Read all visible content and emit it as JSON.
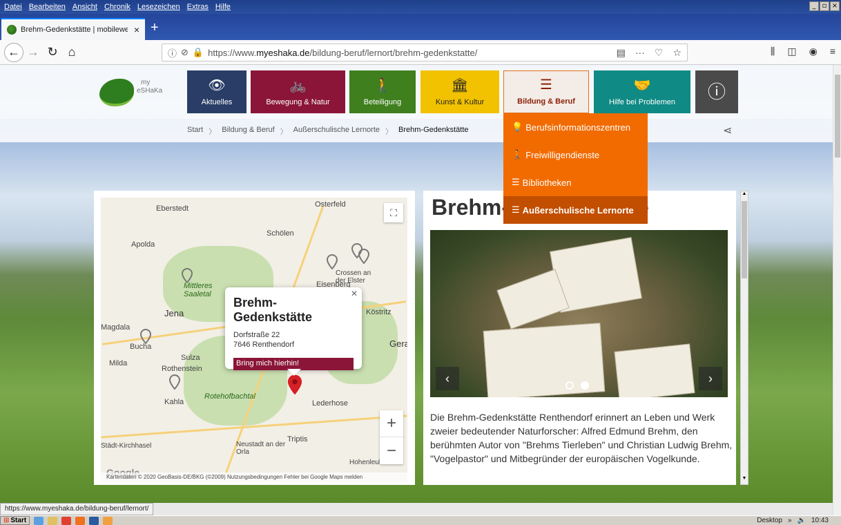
{
  "browser": {
    "menu": [
      "Datei",
      "Bearbeiten",
      "Ansicht",
      "Chronik",
      "Lesezeichen",
      "Extras",
      "Hilfe"
    ],
    "window_buttons": [
      "_",
      "×"
    ],
    "tab_title": "Brehm-Gedenkstätte | mobileweb",
    "tab_close": "×",
    "new_tab": "+",
    "url_prefix": "https://www.",
    "url_domain": "myeshaka.de",
    "url_path": "/bildung-beruf/lernort/brehm-gedenkstatte/",
    "status_link": "https://www.myeshaka.de/bildung-beruf/lernort/"
  },
  "site": {
    "logo_line1": "my",
    "logo_line2": "eSHaKa",
    "nav": [
      {
        "label": "Aktuelles",
        "icon": "eye-icon",
        "glyph": "👁",
        "color": "#2a3d66"
      },
      {
        "label": "Bewegung & Natur",
        "icon": "bicycle-icon",
        "glyph": "🚲",
        "color": "#8a1538"
      },
      {
        "label": "Beteiligung",
        "icon": "person-walking-icon",
        "glyph": "🚶",
        "color": "#3f7f1e"
      },
      {
        "label": "Kunst & Kultur",
        "icon": "building-icon",
        "glyph": "🏛",
        "color": "#f2c200"
      },
      {
        "label": "Bildung & Beruf",
        "icon": "stack-icon",
        "glyph": "☰",
        "color": "#f26b00"
      },
      {
        "label": "Hilfe bei Problemen",
        "icon": "helping-hand-icon",
        "glyph": "🤝",
        "color": "#0f8a84"
      },
      {
        "label": "",
        "icon": "info-icon",
        "glyph": "ⓘ",
        "color": "#4a4a4a"
      }
    ],
    "breadcrumb": [
      "Start",
      "Bildung & Beruf",
      "Außerschulische Lernorte",
      "Brehm-Gedenkstätte"
    ],
    "dropdown": [
      {
        "label": "Berufsinformationszentren",
        "icon": "bulb-icon",
        "glyph": "💡"
      },
      {
        "label": "Freiwilligendienste",
        "icon": "person-walking-icon",
        "glyph": "🚶"
      },
      {
        "label": "Bibliotheken",
        "icon": "stack-icon",
        "glyph": "☰"
      },
      {
        "label": "Außerschulische Lernorte",
        "icon": "stack-icon",
        "glyph": "☰",
        "active": true
      }
    ]
  },
  "map": {
    "labels": [
      "Eberstedt",
      "Osterfeld",
      "Schölen",
      "Apolda",
      "Mittleres Saaletal",
      "Eisenberg",
      "Crossen an der Elster",
      "Jena",
      "Magdala",
      "Köstritz",
      "Gera",
      "Bucha",
      "Sulza",
      "Milda",
      "Rothenstein",
      "Kahla",
      "Rotehofbachtal",
      "Lederhose",
      "Städt-Kirchhasel",
      "Neustadt an der Orla",
      "Triptis",
      "Hohenleuben"
    ],
    "popup": {
      "title": "Brehm-Gedenkstätte",
      "street": "Dorfstraße 22",
      "city": "7646 Renthendorf",
      "button": "Bring mich hierhin!"
    },
    "attribution": "Kartendaten © 2020 GeoBasis-DE/BKG (©2009)   Nutzungsbedingungen   Fehler bei Google Maps melden",
    "google": "Google",
    "zoom_in": "+",
    "zoom_out": "−"
  },
  "content": {
    "title": "Brehm-Gedenkstätte",
    "text": "Die Brehm-Gedenkstätte Renthendorf erinnert an Leben und Werk zweier bedeutender Naturforscher: Alfred Edmund Brehm, den berühmten Autor von \"Brehms Tierleben\" und Christian Ludwig Brehm, \"Vogelpastor\" und Mitbegründer der europäischen Vogelkunde.",
    "slides": 2,
    "active_slide": 2
  },
  "taskbar": {
    "start": "Start",
    "tray": [
      "Desktop",
      "»",
      "10:43"
    ]
  }
}
